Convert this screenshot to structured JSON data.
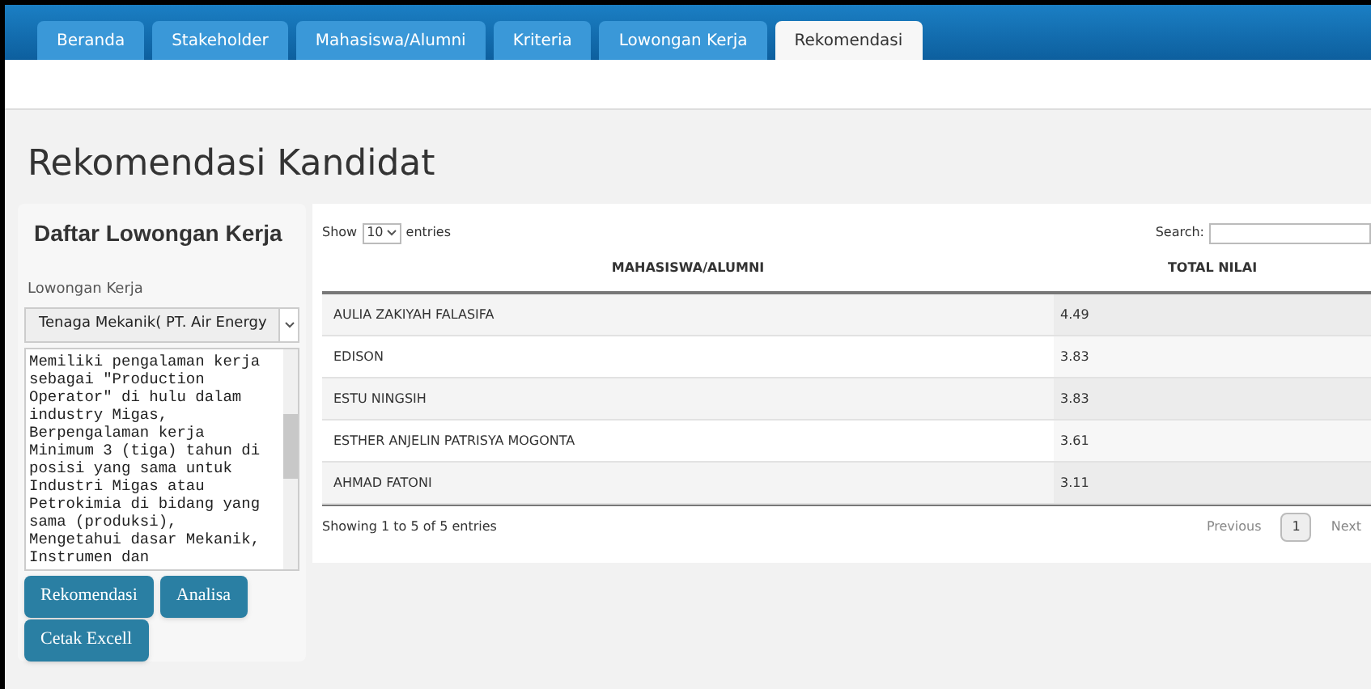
{
  "tabs": [
    {
      "label": "Beranda",
      "selected": false
    },
    {
      "label": "Stakeholder",
      "selected": false
    },
    {
      "label": "Mahasiswa/Alumni",
      "selected": false
    },
    {
      "label": "Kriteria",
      "selected": false
    },
    {
      "label": "Lowongan Kerja",
      "selected": false
    },
    {
      "label": "Rekomendasi",
      "selected": true
    }
  ],
  "page_title": "Rekomendasi Kandidat",
  "sidebar": {
    "title": "Daftar Lowongan Kerja",
    "field_label": "Lowongan Kerja",
    "select_value": "Tenaga Mekanik( PT. Air Energy",
    "description": "Memiliki pengalaman kerja\nsebagai \"Production\nOperator\" di hulu dalam\nindustry Migas,\nBerpengalaman kerja\nMinimum 3 (tiga) tahun di\nposisi yang sama untuk\nIndustri Migas atau\nPetrokimia di bidang yang\nsama (produksi),\nMengetahui dasar Mekanik,\nInstrumen dan",
    "buttons": [
      "Rekomendasi",
      "Analisa",
      "Cetak Excell"
    ]
  },
  "table": {
    "show_label": "Show",
    "page_size": "10",
    "entries_label": "entries",
    "search_label": "Search:",
    "columns": [
      "MAHASISWA/ALUMNI",
      "TOTAL NILAI"
    ],
    "rows": [
      [
        "AULIA ZAKIYAH FALASIFA",
        "4.49"
      ],
      [
        "EDISON",
        "3.83"
      ],
      [
        "ESTU NINGSIH",
        "3.83"
      ],
      [
        "ESTHER ANJELIN PATRISYA MOGONTA",
        "3.61"
      ],
      [
        "AHMAD FATONI",
        "3.11"
      ]
    ],
    "info": "Showing 1 to 5 of 5 entries",
    "pagination": [
      {
        "label": "Previous",
        "selected": false
      },
      {
        "label": "1",
        "selected": true
      },
      {
        "label": "Next",
        "selected": false
      }
    ]
  }
}
